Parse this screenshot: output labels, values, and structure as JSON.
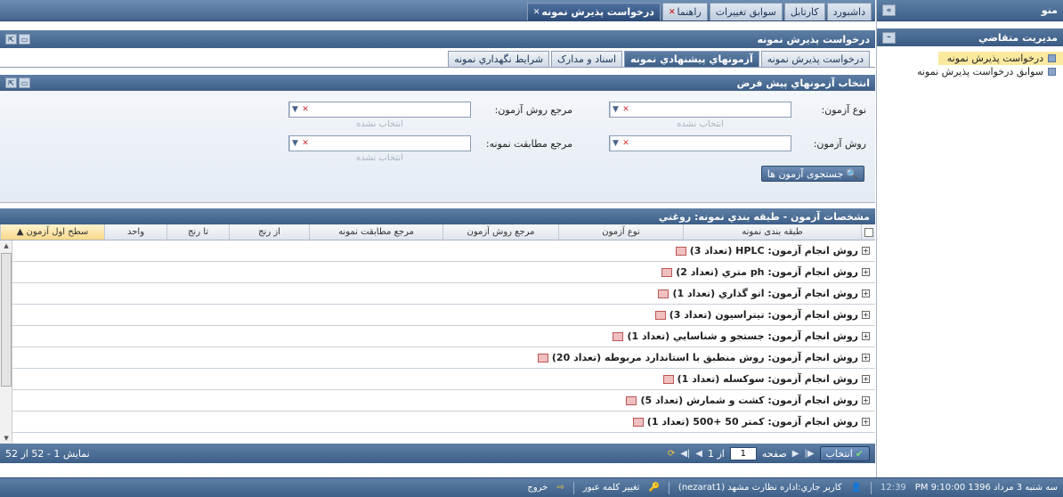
{
  "sidebar": {
    "title": "منو",
    "section": "مديريت متقاضي",
    "items": [
      {
        "label": "درخواست پذيرش نمونه"
      },
      {
        "label": "سوابق درخواست پذيرش نمونه"
      }
    ]
  },
  "tabs": [
    {
      "label": "داشبورد"
    },
    {
      "label": "کارتابل"
    },
    {
      "label": "سوابق تغييرات"
    },
    {
      "label": "راهنما"
    },
    {
      "label": "درخواست پذيرش نمونه"
    }
  ],
  "panel": {
    "title": "درخواست پذيرش نمونه"
  },
  "subtabs": [
    {
      "label": "درخواست پذيرش نمونه"
    },
    {
      "label": "آزمونهاي پيشنهادي نمونه"
    },
    {
      "label": "اسناد و مدارک"
    },
    {
      "label": "شرايط نگهداري نمونه"
    }
  ],
  "filter": {
    "title": "انتخاب آزمونهاي پيش فرض",
    "test_type_label": "نوع آزمون:",
    "test_method_ref_label": "مرجع روش آزمون:",
    "test_method_label": "روش آزمون:",
    "sample_conformity_ref_label": "مرجع مطابقت نمونه:",
    "hint": "انتخاب نشده",
    "search_button": "جستجوی آزمون ها"
  },
  "grid": {
    "title": "مشخصات آزمون - طبقه بندي نمونه: روغني",
    "columns": [
      "طبقه بندی نمونه",
      "نوع آزمون",
      "مرجع روش آزمون",
      "مرجع مطابقت نمونه",
      "از رنج",
      "تا رنج",
      "واحد",
      "سطح اول آزمون ▲"
    ],
    "rows": [
      {
        "label": "روش انجام آزمون: HPLC (تعداد 3)"
      },
      {
        "label": "روش انجام آزمون: ph متري (تعداد 2)"
      },
      {
        "label": "روش انجام آزمون: اتو گذاري (تعداد 1)"
      },
      {
        "label": "روش انجام آزمون: تيتراسيون (تعداد 3)"
      },
      {
        "label": "روش انجام آزمون: جستجو و شناسايي (تعداد 1)"
      },
      {
        "label": "روش انجام آزمون: روش منطبق با استاندارد مربوطه (تعداد 20)"
      },
      {
        "label": "روش انجام آزمون: سوکسله (تعداد 1)"
      },
      {
        "label": "روش انجام آزمون: کشت و شمارش (تعداد 5)"
      },
      {
        "label": "روش انجام آزمون: کمتر 50 +500 (تعداد 1)"
      }
    ]
  },
  "pager": {
    "select_button": "انتخاب",
    "page_label": "صفحه",
    "page_value": "1",
    "of_label": "از 1",
    "summary": "نمایش 1 - 52 از 52"
  },
  "status": {
    "datetime": "سه شنبه 3 مرداد 1396 PM 9:10:00",
    "time": "12:39",
    "user": "کاربر جاري:اداره نظارت مشهد (nezarat1)",
    "change_password": "تغيير کلمه عبور",
    "logout": "خروج"
  }
}
